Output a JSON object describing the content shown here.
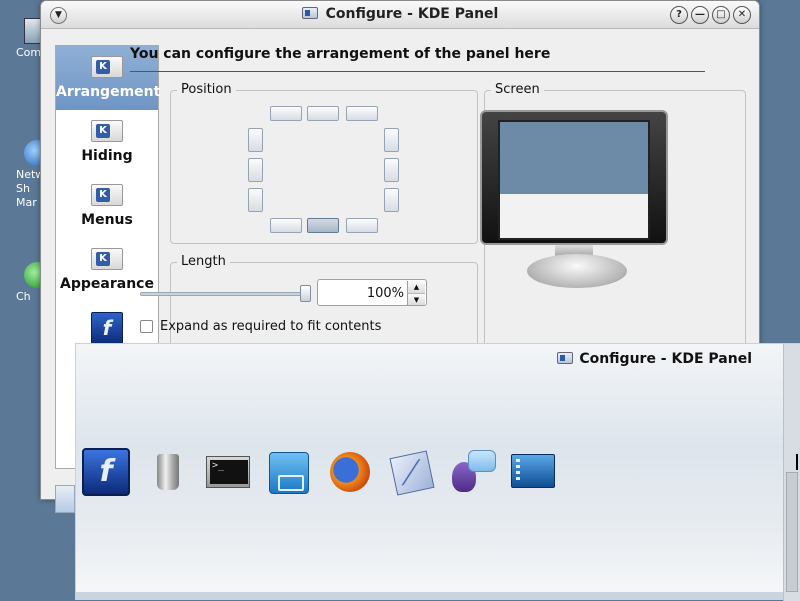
{
  "desktop": {
    "icons": [
      {
        "label": "Com",
        "icon": "computer-icon"
      },
      {
        "label": "Netw Sh Mar",
        "icon": "network-icon"
      },
      {
        "label": "Ch",
        "icon": "chat-icon"
      }
    ]
  },
  "window": {
    "title": "Configure - KDE Panel",
    "buttons": [
      "?",
      "—",
      "□",
      "✕"
    ]
  },
  "categories": [
    {
      "label": "Arrangement",
      "selected": true,
      "icon": "kde-icon"
    },
    {
      "label": "Hiding",
      "selected": false,
      "icon": "kde-icon"
    },
    {
      "label": "Menus",
      "selected": false,
      "icon": "kde-icon"
    },
    {
      "label": "Appearance",
      "selected": false,
      "icon": "kde-icon"
    },
    {
      "label": "",
      "selected": false,
      "icon": "kmenu-icon"
    }
  ],
  "main": {
    "heading": "You can configure the arrangement of the panel here",
    "position": {
      "title": "Position",
      "selected": "bottom-center"
    },
    "screen": {
      "title": "Screen"
    },
    "length": {
      "title": "Length",
      "value": "100%",
      "slider_fraction": 1.0,
      "expand_label": "Expand as required to fit contents",
      "expand_checked": false
    }
  },
  "panel_overlay": {
    "title": "Configure - KDE Panel",
    "launchers": [
      {
        "name": "kmenu-launcher",
        "icon": "kmenu-icon"
      },
      {
        "name": "trash-launcher",
        "icon": "trash-icon"
      },
      {
        "name": "terminal-launcher",
        "icon": "terminal-icon"
      },
      {
        "name": "file-manager-launcher",
        "icon": "file-cabinet-icon"
      },
      {
        "name": "firefox-launcher",
        "icon": "firefox-icon"
      },
      {
        "name": "mail-launcher",
        "icon": "mail-icon"
      },
      {
        "name": "chat-launcher",
        "icon": "chat-bird-icon"
      },
      {
        "name": "desktop-launcher",
        "icon": "desktop-icon"
      }
    ]
  },
  "colors": {
    "desktop_bg": "#5b7896",
    "selection": "#7a9dca",
    "screen_panel": "#6d8aa6"
  }
}
